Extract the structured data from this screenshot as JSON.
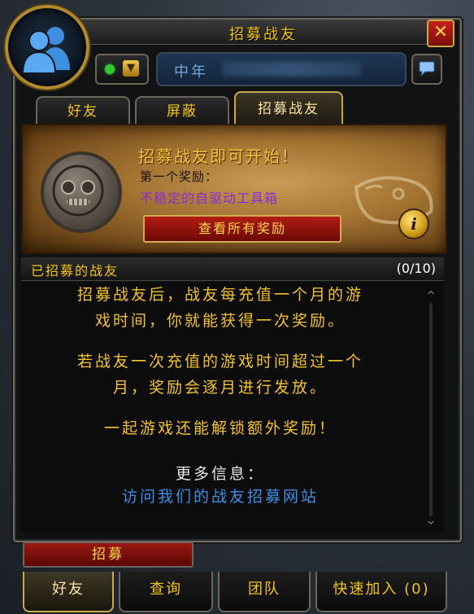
{
  "window": {
    "title": "招募战友"
  },
  "header": {
    "name_visible": "中年"
  },
  "tabs": [
    {
      "label": "好友"
    },
    {
      "label": "屏蔽"
    },
    {
      "label": "招募战友"
    }
  ],
  "reward_panel": {
    "headline": "招募战友即可开始！",
    "first_reward_label": "第一个奖励：",
    "first_reward_item": "不稳定的自驱动工具箱",
    "view_all_button": "查看所有奖励",
    "info_glyph": "i"
  },
  "recruited": {
    "title": "已招募的战友",
    "count": "(0/10)"
  },
  "messages": {
    "line1": "招募战友后，战友每充值一个月的游",
    "line2": "戏时间，你就能获得一次奖励。",
    "line3": "若战友一次充值的游戏时间超过一个",
    "line4": "月，奖励会逐月进行发放。",
    "line5": "一起游戏还能解锁额外奖励！",
    "more_info": "更多信息：",
    "link": "访问我们的战友招募网站"
  },
  "recruit_button": "招募",
  "bottom_tabs": [
    {
      "label": "好友"
    },
    {
      "label": "查询"
    },
    {
      "label": "团队"
    },
    {
      "label": "快速加入 (0)"
    }
  ],
  "colors": {
    "gold_text": "#f0c419",
    "purple_item": "#8c2bd6",
    "link_blue": "#3d8ee6",
    "status_green": "#2fc934"
  },
  "icons": {
    "portrait": "friends-silhouette-icon",
    "close": "close-x-icon",
    "status": "online-dot-icon",
    "dropdown": "chevron-down-icon",
    "chat": "speech-bubble-icon",
    "info": "info-icon",
    "coin": "coin-face-icon"
  }
}
